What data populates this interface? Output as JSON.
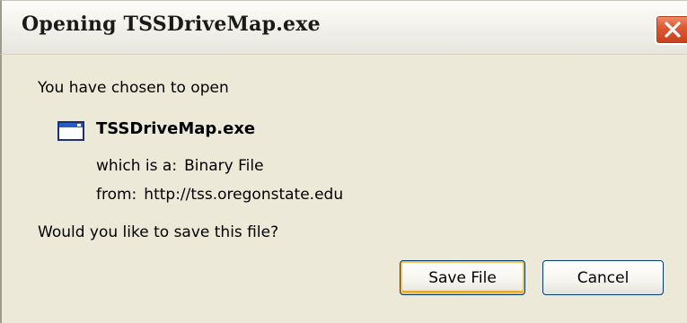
{
  "dialog": {
    "title": "Opening TSSDriveMap.exe",
    "intro": "You have chosen to open",
    "file": {
      "name": "TSSDriveMap.exe",
      "icon": "application-window-icon"
    },
    "type_label": "which is a:",
    "type_value": "Binary File",
    "from_label": "from:",
    "from_value": "http://tss.oregonstate.edu",
    "question": "Would you like to save this file?",
    "buttons": {
      "save": "Save File",
      "cancel": "Cancel"
    },
    "close_icon": "close-icon",
    "colors": {
      "dialog_background": "#ece9d8",
      "close_button": "#dd5a35",
      "default_button_focus": "#f2c25a"
    }
  }
}
